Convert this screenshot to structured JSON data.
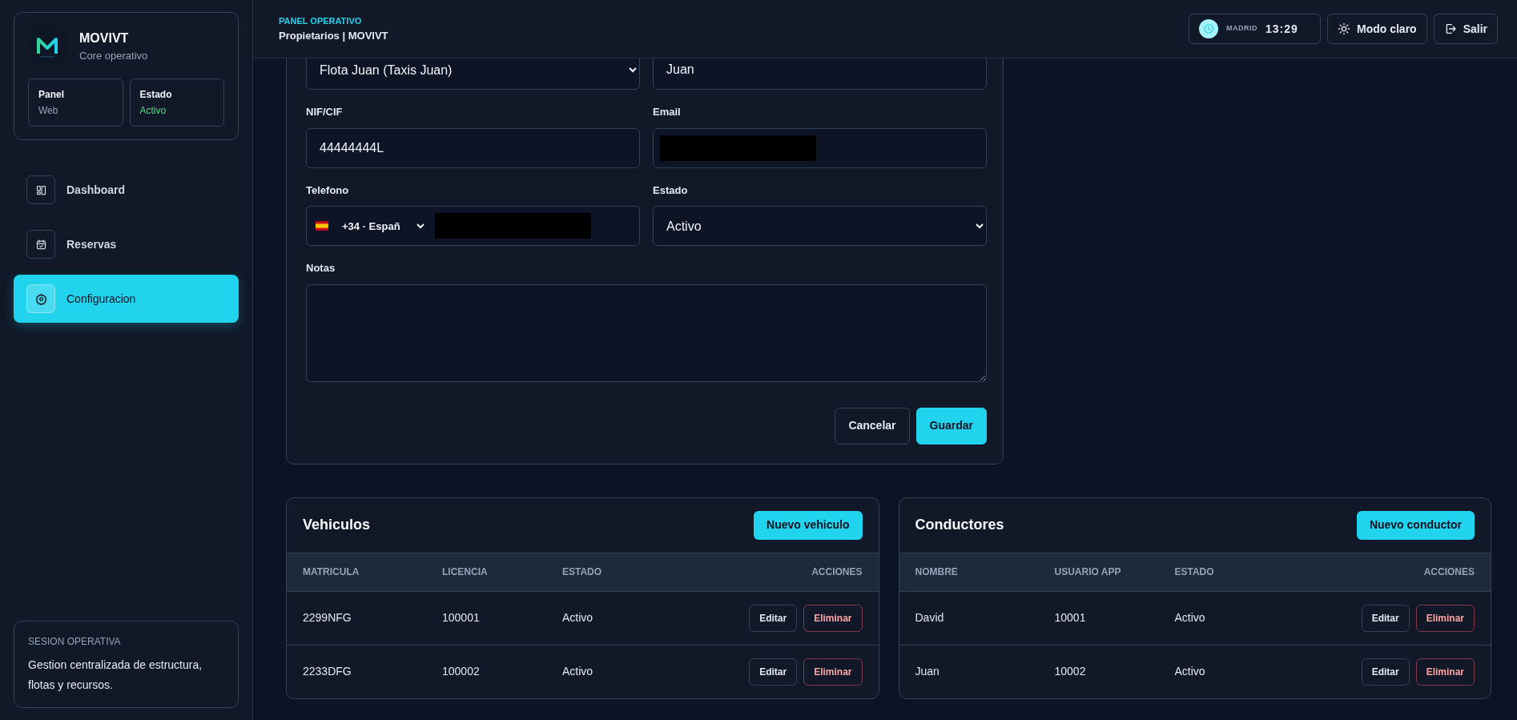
{
  "sidebar": {
    "brand": {
      "name": "MOVIVT",
      "subtitle": "Core operativo"
    },
    "stats": [
      {
        "label": "Panel",
        "value": "Web",
        "kind": "plain"
      },
      {
        "label": "Estado",
        "value": "Activo",
        "kind": "success"
      }
    ],
    "items": [
      {
        "label": "Dashboard",
        "kind": "dashboard",
        "selected": false
      },
      {
        "label": "Reservas",
        "kind": "calendar",
        "selected": false
      },
      {
        "label": "Configuracion",
        "kind": "gear",
        "selected": true
      }
    ],
    "session": {
      "title": "SESION OPERATIVA",
      "text": "Gestion centralizada de estructura, flotas y recursos."
    }
  },
  "header": {
    "eyebrow": "PANEL OPERATIVO",
    "title": "Propietarios | MOVIVT",
    "clock": {
      "city": "MADRID",
      "time": "13:29"
    },
    "buttons": [
      {
        "label": "Modo claro",
        "kind": "sun"
      },
      {
        "label": "Salir",
        "kind": "logout"
      }
    ]
  },
  "form": {
    "top_fields": [
      {
        "kind": "select",
        "value": "Flota Juan (Taxis Juan)"
      },
      {
        "kind": "input",
        "value": "Juan"
      }
    ],
    "fields": [
      {
        "label": "NIF/CIF",
        "kind": "input",
        "value": "44444444L"
      },
      {
        "label": "Email",
        "kind": "input",
        "redacted": true
      },
      {
        "label": "Telefono",
        "kind": "phone",
        "prefix": "+34 · Españ",
        "redacted": true
      },
      {
        "label": "Estado",
        "kind": "select",
        "value": "Activo"
      }
    ],
    "notes": {
      "label": "Notas"
    },
    "buttons": [
      {
        "label": "Cancelar",
        "kind": "secondary"
      },
      {
        "label": "Guardar",
        "kind": "primary"
      }
    ]
  },
  "tables": [
    {
      "title": "Vehiculos",
      "action": "Nuevo vehiculo",
      "columns": [
        "MATRICULA",
        "LICENCIA",
        "ESTADO",
        "ACCIONES"
      ],
      "rows": [
        {
          "cells": [
            "2299NFG",
            "100001",
            "Activo"
          ],
          "actions": [
            "Editar",
            "Eliminar"
          ]
        },
        {
          "cells": [
            "2233DFG",
            "100002",
            "Activo"
          ],
          "actions": [
            "Editar",
            "Eliminar"
          ]
        }
      ]
    },
    {
      "title": "Conductores",
      "action": "Nuevo conductor",
      "columns": [
        "NOMBRE",
        "USUARIO APP",
        "ESTADO",
        "ACCIONES"
      ],
      "rows": [
        {
          "cells": [
            "David",
            "10001",
            "Activo"
          ],
          "actions": [
            "Editar",
            "Eliminar"
          ]
        },
        {
          "cells": [
            "Juan",
            "10002",
            "Activo"
          ],
          "actions": [
            "Editar",
            "Eliminar"
          ]
        }
      ]
    }
  ]
}
